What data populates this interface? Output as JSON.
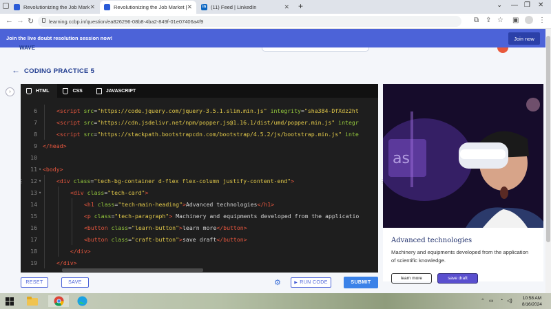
{
  "browser": {
    "tabs": [
      {
        "title": "Revolutionizing the Job Market |",
        "favicon_color": "#2a5bd7",
        "active": false
      },
      {
        "title": "Revolutionizing the Job Market |",
        "favicon_color": "#2a5bd7",
        "active": true
      },
      {
        "title": "(11) Feed | LinkedIn",
        "favicon_color": "#0a66c2",
        "favicon_text": "in",
        "active": false
      }
    ],
    "url": "learning.ccbp.in/question/ea826296-08b8-4ba2-849f-01e07406a4f9"
  },
  "banner": {
    "text": "Join the live doubt resolution session now!",
    "button_label": "Join now",
    "color": "#4c63d8"
  },
  "header": {
    "logo_text": "WAVE",
    "title": "CODING PRACTICE 5"
  },
  "editor": {
    "tabs": [
      {
        "label": "HTML",
        "icon": "html5-icon"
      },
      {
        "label": "CSS",
        "icon": "css3-icon"
      },
      {
        "label": "JAVASCRIPT",
        "icon": "file-icon"
      }
    ],
    "lines": [
      {
        "num": "6",
        "indent": 1,
        "tokens": [
          [
            "tag",
            "<script "
          ],
          [
            "attr",
            "src"
          ],
          [
            "plain",
            "="
          ],
          [
            "str",
            "\"https://code.jquery.com/jquery-3.5.1.slim.min.js\""
          ],
          [
            "plain",
            " "
          ],
          [
            "attr",
            "integrity"
          ],
          [
            "plain",
            "="
          ],
          [
            "str",
            "\"sha384-DfXdz2ht"
          ]
        ]
      },
      {
        "num": "7",
        "indent": 1,
        "tokens": [
          [
            "tag",
            "<script "
          ],
          [
            "attr",
            "src"
          ],
          [
            "plain",
            "="
          ],
          [
            "str",
            "\"https://cdn.jsdelivr.net/npm/popper.js@1.16.1/dist/umd/popper.min.js\""
          ],
          [
            "plain",
            " "
          ],
          [
            "attr",
            "integr"
          ]
        ]
      },
      {
        "num": "8",
        "indent": 1,
        "tokens": [
          [
            "tag",
            "<script "
          ],
          [
            "attr",
            "src"
          ],
          [
            "plain",
            "="
          ],
          [
            "str",
            "\"https://stackpath.bootstrapcdn.com/bootstrap/4.5.2/js/bootstrap.min.js\""
          ],
          [
            "plain",
            " "
          ],
          [
            "attr",
            "inte"
          ]
        ]
      },
      {
        "num": "9",
        "indent": 0,
        "tokens": [
          [
            "tag",
            "</head>"
          ]
        ]
      },
      {
        "num": "10",
        "indent": 0,
        "tokens": []
      },
      {
        "num": "11",
        "indent": 0,
        "fold": true,
        "tokens": [
          [
            "tag",
            "<body>"
          ]
        ]
      },
      {
        "num": "12",
        "indent": 1,
        "fold": true,
        "tokens": [
          [
            "tag",
            "<div "
          ],
          [
            "attr",
            "class"
          ],
          [
            "plain",
            "="
          ],
          [
            "str",
            "\"tech-bg-container d-flex flex-column justify-content-end\""
          ],
          [
            "tag",
            ">"
          ]
        ]
      },
      {
        "num": "13",
        "indent": 2,
        "fold": true,
        "tokens": [
          [
            "tag",
            "<div "
          ],
          [
            "attr",
            "class"
          ],
          [
            "plain",
            "="
          ],
          [
            "str",
            "\"tech-card\""
          ],
          [
            "tag",
            ">"
          ]
        ]
      },
      {
        "num": "14",
        "indent": 3,
        "tokens": [
          [
            "tag",
            "<h1 "
          ],
          [
            "attr",
            "class"
          ],
          [
            "plain",
            "="
          ],
          [
            "str",
            "\"tech-main-heading\""
          ],
          [
            "tag",
            ">"
          ],
          [
            "plain",
            "Advanced technologies"
          ],
          [
            "tag",
            "</h1>"
          ]
        ]
      },
      {
        "num": "15",
        "indent": 3,
        "tokens": [
          [
            "tag",
            "<p "
          ],
          [
            "attr",
            "class"
          ],
          [
            "plain",
            "="
          ],
          [
            "str",
            "\"tech-paragraph\""
          ],
          [
            "tag",
            ">"
          ],
          [
            "plain",
            " Machinery and equipments developed from the applicatio"
          ]
        ]
      },
      {
        "num": "16",
        "indent": 3,
        "tokens": [
          [
            "tag",
            "<button "
          ],
          [
            "attr",
            "class"
          ],
          [
            "plain",
            "="
          ],
          [
            "str",
            "\"learn-button\""
          ],
          [
            "tag",
            ">"
          ],
          [
            "plain",
            "learn more"
          ],
          [
            "tag",
            "</button>"
          ]
        ]
      },
      {
        "num": "17",
        "indent": 3,
        "tokens": [
          [
            "tag",
            "<button "
          ],
          [
            "attr",
            "class"
          ],
          [
            "plain",
            "="
          ],
          [
            "str",
            "\"craft-button\""
          ],
          [
            "tag",
            ">"
          ],
          [
            "plain",
            "save draft"
          ],
          [
            "tag",
            "</button>"
          ]
        ]
      },
      {
        "num": "18",
        "indent": 2,
        "tokens": [
          [
            "tag",
            "</div>"
          ]
        ]
      },
      {
        "num": "19",
        "indent": 1,
        "tokens": [
          [
            "tag",
            "</div>"
          ]
        ]
      },
      {
        "num": "20",
        "indent": 0,
        "tokens": []
      }
    ]
  },
  "actions": {
    "reset_label": "RESET",
    "save_label": "SAVE",
    "run_label": "RUN CODE",
    "submit_label": "SUBMIT"
  },
  "preview": {
    "heading": "Advanced technologies",
    "paragraph": "Machinery and equipments developed from the application of scientific knowledge.",
    "learn_button": "learn more",
    "draft_button": "save draft"
  },
  "taskbar": {
    "time": "10:58 AM",
    "date": "8/16/2024"
  }
}
